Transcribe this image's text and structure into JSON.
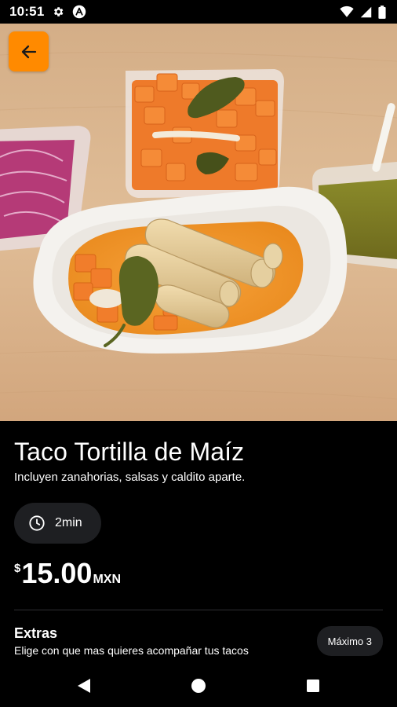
{
  "status_bar": {
    "time": "10:51",
    "left_icons": [
      "gear-icon",
      "app-icon"
    ],
    "right_icons": [
      "wifi-icon",
      "signal-icon",
      "battery-icon"
    ]
  },
  "header": {
    "back_icon": "arrow-left-icon",
    "accent_color": "#ff8a00"
  },
  "product": {
    "title": "Taco Tortilla de Maíz",
    "description": "Incluyen zanahorias, salsas y caldito aparte.",
    "time_icon": "clock-icon",
    "time": "2min",
    "price_symbol": "$",
    "price": "15.00",
    "currency": "MXN"
  },
  "extras": {
    "title": "Extras",
    "subtitle": "Elige con que mas quieres acompañar tus tacos",
    "badge": "Máximo 3"
  },
  "nav": {
    "icons": [
      "back-triangle-icon",
      "home-circle-icon",
      "recents-square-icon"
    ]
  },
  "colors": {
    "background": "#000000",
    "chip": "#1e1f22",
    "accent": "#ff8a00"
  }
}
